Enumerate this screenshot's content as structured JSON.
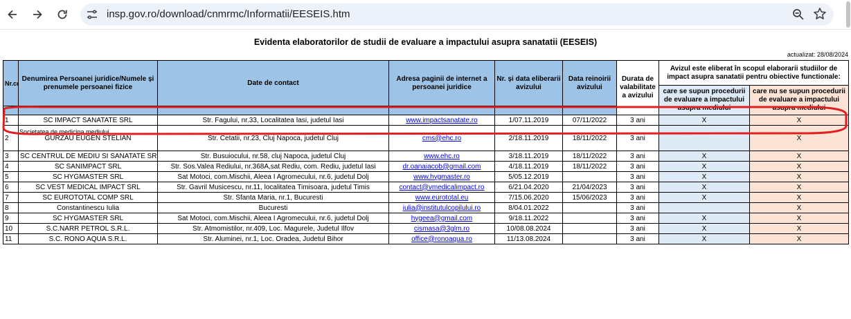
{
  "browser": {
    "url": "insp.gov.ro/download/cnmrmc/Informatii/EESEIS.htm"
  },
  "document": {
    "title": "Evidenta elaboratorilor de studii de evaluare a impactului asupra sanatatii (EESEIS)",
    "updated": "actualizat: 28/08/2024",
    "headers": {
      "nr": "Nr.crt.",
      "name": "Denumirea Persoanei juridice/Numele și prenumele persoanei fizice",
      "contact": "Date de contact",
      "web": "Adresa paginii de internet a persoanei juridice",
      "issued": "Nr. și data eliberarii avizului",
      "renewed": "Data reinoirii avizului",
      "validity": "Durata de valabilitate a avizului",
      "purpose": "Avizul este eliberat în scopul elaborarii studiilor de impact asupra sanatatii pentru obiective functionale:",
      "purpose_a": "care se supun procedurii de evaluare a impactului asupra mediului",
      "purpose_b": "care nu se supun procedurii de evaluare a impactului asupra mediului"
    },
    "overflow_text": "Societatea de medicina mediului",
    "rows": [
      {
        "nr": "1",
        "name": "SC IMPACT SANATATE SRL",
        "contact": "Str. Fagului, nr.33, Localitatea Iasi, judetul Iasi",
        "web": "www.impactsanatate.ro",
        "issued": "1/07.11.2019",
        "renewed": "07/11/2022",
        "validity": "3 ani",
        "a": "X",
        "b": "X"
      },
      {
        "nr": "2",
        "name": "GURZAU EUGEN STELIAN",
        "contact": "Str. Cetatii, nr.23, Cluj Napoca, judetul Cluj",
        "web": "cms@ehc.ro",
        "issued": "2/18.11.2019",
        "renewed": "18/11/2022",
        "validity": "3 ani",
        "a": "",
        "b": "X"
      },
      {
        "nr": "3",
        "name": "SC CENTRUL DE MEDIU SI SANATATE SRL",
        "contact": "Str. Busuiocului, nr.58, cluj Napoca, judetul Cluj",
        "web": "www.ehc.ro",
        "issued": "3/18.11.2019",
        "renewed": "18/11/2022",
        "validity": "3 ani",
        "a": "X",
        "b": "X"
      },
      {
        "nr": "4",
        "name": "SC SANIMPACT SRL",
        "contact": "Str. Sos.Valea Rediului, nr.368A,sat Rediu, com. Rediu, judetul Iasi",
        "web": "dr.oanaiacob@gmail.com",
        "issued": "4/18.11.2019",
        "renewed": "18/11/2022",
        "validity": "3 ani",
        "a": "X",
        "b": "X"
      },
      {
        "nr": "5",
        "name": "SC HYGMASTER SRL",
        "contact": "Sat Motoci, com.Mischii, Aleea I Agromecului, nr.6, judetul Dolj",
        "web": "www.hygmaster.ro",
        "issued": "5/05.12.2019",
        "renewed": "",
        "validity": "3 ani",
        "a": "X",
        "b": "X"
      },
      {
        "nr": "6",
        "name": "SC VEST MEDICAL IMPACT SRL",
        "contact": "Str. Gavril Musicescu, nr.11, localitatea Timisoara, judetul Timis",
        "web": "contact@vmedicalimpact.ro",
        "issued": "6/21.04.2020",
        "renewed": "21/04/2023",
        "validity": "3 ani",
        "a": "X",
        "b": "X"
      },
      {
        "nr": "7",
        "name": "SC EUROTOTAL COMP SRL",
        "contact": "Str. Sfanta Maria, nr.1, Bucuresti",
        "web": "www.eurototal.eu",
        "issued": "7/15.06.2020",
        "renewed": "15/06/2023",
        "validity": "3 ani",
        "a": "X",
        "b": "X"
      },
      {
        "nr": "8",
        "name": "Constantinescu Iulia",
        "contact": "Bucuresti",
        "web": "iulia@institutulcopilului.ro",
        "issued": "8/04.01.2022",
        "renewed": "",
        "validity": "3 ani",
        "a": "",
        "b": "X"
      },
      {
        "nr": "9",
        "name": "SC HYGMASTER SRL",
        "contact": "Sat Motoci, com.Mischii, Aleea I Agromecului, nr.6, judetul Dolj",
        "web": "hygeea@gmail.com",
        "issued": "9/18.11.2022",
        "renewed": "",
        "validity": "3 ani",
        "a": "X",
        "b": "X"
      },
      {
        "nr": "10",
        "name": "S.C.NARR PETROL S.R.L.",
        "contact": "Str. Atmomistilor, nr.409, Loc. Magurele, Judetul Ilfov",
        "web": "cismasa@3glm.ro",
        "issued": "10/08.08.2024",
        "renewed": "",
        "validity": "3 ani",
        "a": "X",
        "b": "X"
      },
      {
        "nr": "11",
        "name": "S.C. RONO AQUA S.R.L.",
        "contact": "Str. Aluminei, nr.1, Loc. Oradea, Judetul Bihor",
        "web": "office@ronoaqua.ro",
        "issued": "11/13.08.2024",
        "renewed": "",
        "validity": "3 ani",
        "a": "X",
        "b": "X"
      }
    ]
  },
  "colors": {
    "header_blue": "#9dc3e6",
    "light_blue": "#deebf7",
    "light_peach": "#fbe4d5",
    "highlight_red": "#e02020"
  },
  "icons": [
    "back-arrow-icon",
    "forward-arrow-icon",
    "reload-icon",
    "site-settings-icon",
    "zoom-icon",
    "bookmark-star-icon"
  ]
}
